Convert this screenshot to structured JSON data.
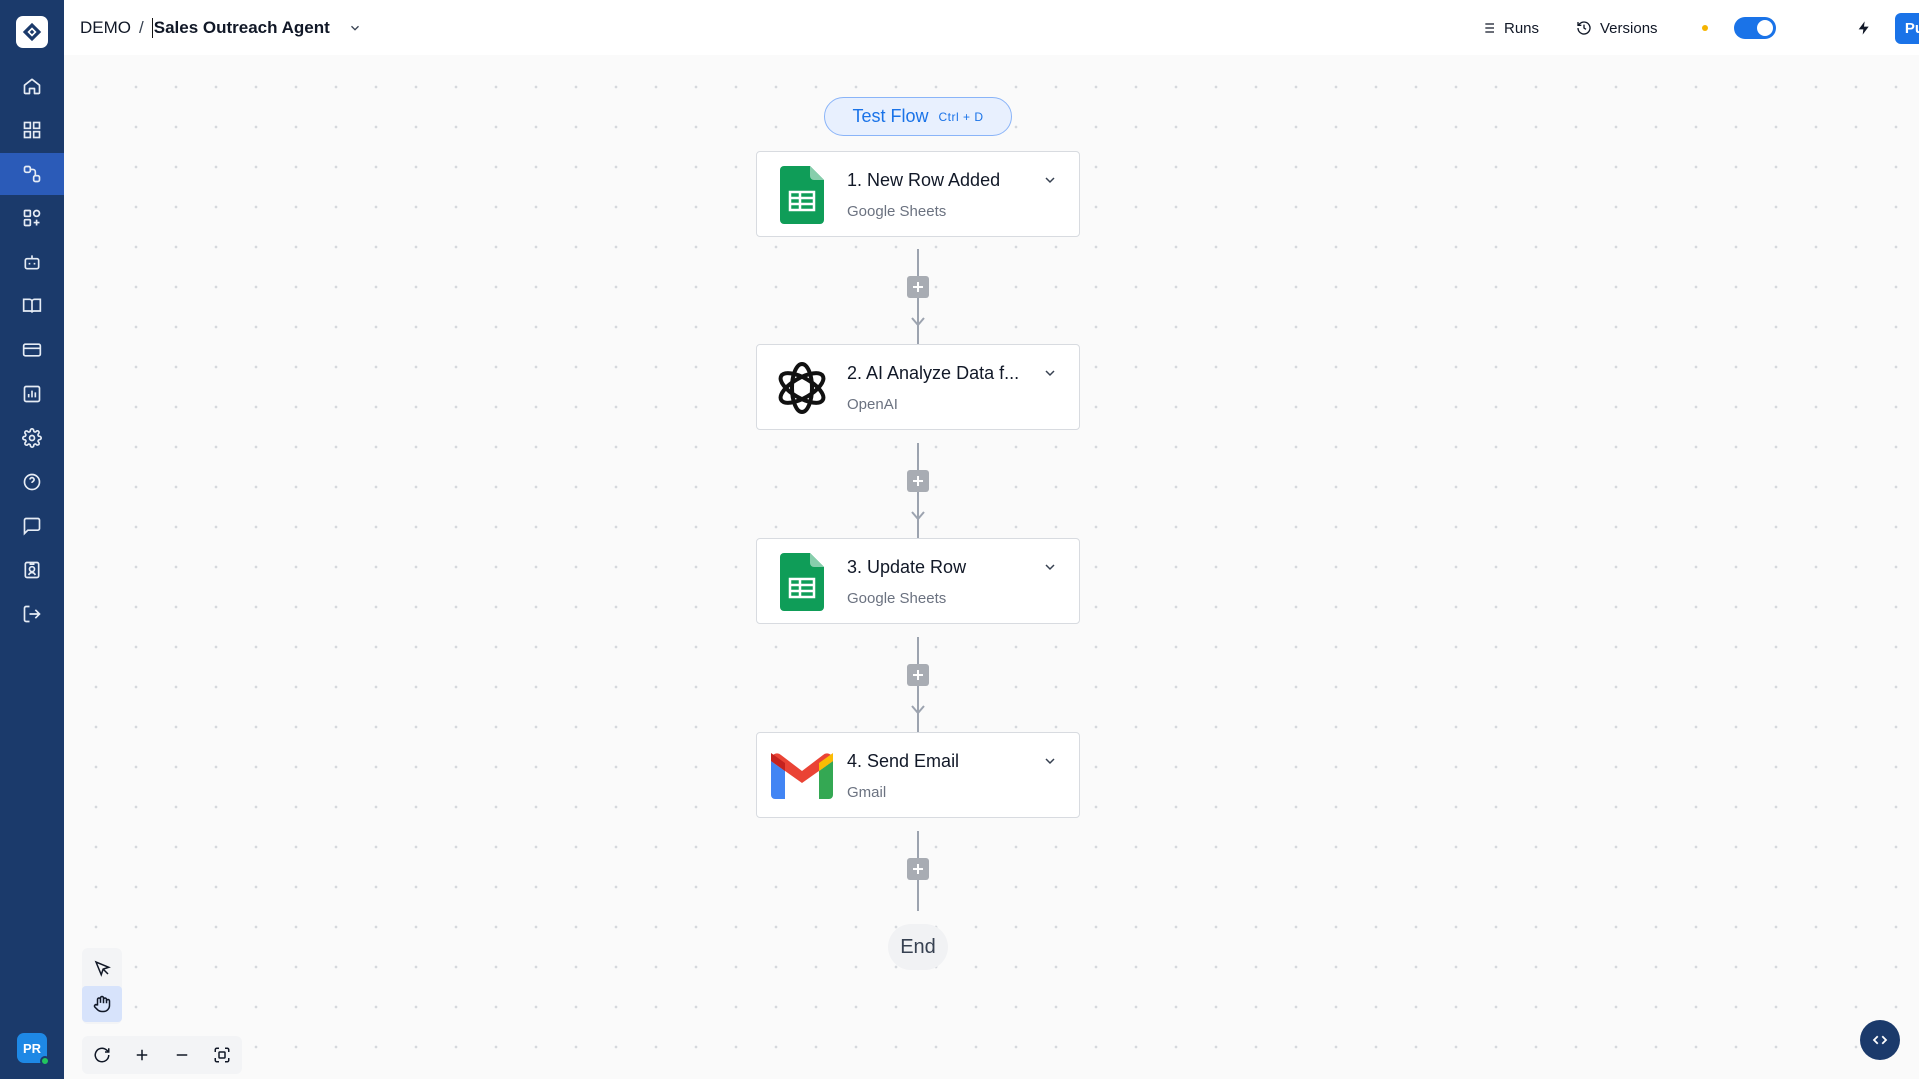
{
  "header": {
    "project": "DEMO",
    "separator": "/",
    "flow_name": "Sales Outreach Agent",
    "runs_label": "Runs",
    "versions_label": "Versions",
    "publish_label": "Publish"
  },
  "user": {
    "initials": "PR"
  },
  "sidebar": {
    "items": [
      {
        "icon": "home-icon"
      },
      {
        "icon": "dashboard-grid-icon"
      },
      {
        "icon": "flows-icon",
        "active": true
      },
      {
        "icon": "apps-icon"
      },
      {
        "icon": "bot-icon"
      },
      {
        "icon": "book-icon"
      },
      {
        "icon": "card-icon"
      },
      {
        "icon": "chart-icon"
      },
      {
        "icon": "gear-icon"
      },
      {
        "icon": "help-icon"
      },
      {
        "icon": "chat-icon"
      },
      {
        "icon": "badge-icon"
      },
      {
        "icon": "logout-icon"
      }
    ]
  },
  "canvas": {
    "test_flow_label": "Test Flow",
    "test_flow_shortcut": "Ctrl + D",
    "steps": [
      {
        "title": "1. New Row Added",
        "app": "Google Sheets",
        "icon": "google-sheets-icon"
      },
      {
        "title": "2. AI Analyze Data f...",
        "app": "OpenAI",
        "icon": "openai-icon"
      },
      {
        "title": "3. Update Row",
        "app": "Google Sheets",
        "icon": "google-sheets-icon"
      },
      {
        "title": "4. Send Email",
        "app": "Gmail",
        "icon": "gmail-icon"
      }
    ],
    "end_label": "End"
  },
  "colors": {
    "sidebar": "#1b3a6b",
    "accent": "#1a73e8",
    "sheets_green": "#0f9d58",
    "status_dot": "#f5b400"
  }
}
